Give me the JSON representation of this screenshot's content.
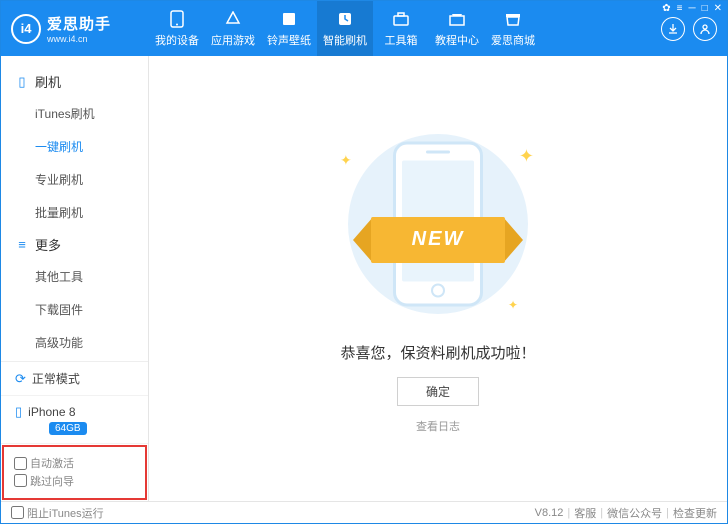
{
  "header": {
    "logo_badge": "i4",
    "logo_title": "爱思助手",
    "logo_sub": "www.i4.cn",
    "nav": [
      {
        "label": "我的设备",
        "icon": "phone"
      },
      {
        "label": "应用游戏",
        "icon": "app"
      },
      {
        "label": "铃声壁纸",
        "icon": "music"
      },
      {
        "label": "智能刷机",
        "icon": "flash",
        "active": true
      },
      {
        "label": "工具箱",
        "icon": "toolbox"
      },
      {
        "label": "教程中心",
        "icon": "book"
      },
      {
        "label": "爱思商城",
        "icon": "shop"
      }
    ]
  },
  "sidebar": {
    "sections": [
      {
        "title": "刷机",
        "icon": "phone",
        "items": [
          {
            "label": "iTunes刷机"
          },
          {
            "label": "一键刷机",
            "active": true
          },
          {
            "label": "专业刷机"
          },
          {
            "label": "批量刷机"
          }
        ]
      },
      {
        "title": "更多",
        "icon": "more",
        "items": [
          {
            "label": "其他工具"
          },
          {
            "label": "下载固件"
          },
          {
            "label": "高级功能"
          }
        ]
      }
    ],
    "mode_label": "正常模式",
    "device_label": "iPhone 8",
    "device_badge": "64GB",
    "opt_auto_activate": "自动激活",
    "opt_skip_guide": "跳过向导"
  },
  "main": {
    "ribbon_text": "NEW",
    "success_text": "恭喜您，保资料刷机成功啦！",
    "ok_btn": "确定",
    "log_link": "查看日志"
  },
  "footer": {
    "block_itunes": "阻止iTunes运行",
    "version": "V8.12",
    "support": "客服",
    "wechat": "微信公众号",
    "check_update": "检查更新"
  }
}
